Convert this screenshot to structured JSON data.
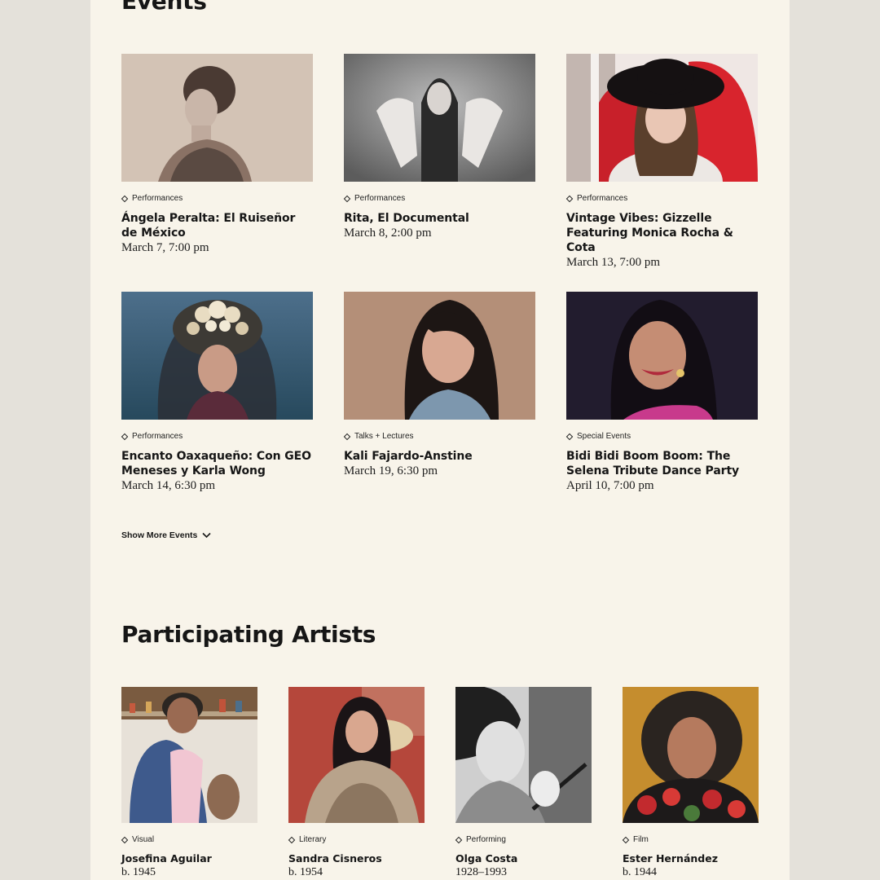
{
  "events_section": {
    "title": "Events",
    "events": [
      {
        "category": "Performances",
        "title": "Ángela Peralta: El Ruiseñor de México",
        "date": "March 7, 7:00 pm"
      },
      {
        "category": "Performances",
        "title": "Rita, El Documental",
        "date": "March 8, 2:00 pm"
      },
      {
        "category": "Performances",
        "title": "Vintage Vibes: Gizzelle Featuring Monica Rocha & Cota",
        "date": "March 13, 7:00 pm"
      },
      {
        "category": "Performances",
        "title": "Encanto Oaxaqueño: Con GEO Meneses y Karla Wong",
        "date": "March 14, 6:30 pm"
      },
      {
        "category": "Talks + Lectures",
        "title": "Kali Fajardo-Anstine",
        "date": "March 19, 6:30 pm"
      },
      {
        "category": "Special Events",
        "title": "Bidi Bidi Boom Boom: The Selena Tribute Dance Party",
        "date": "April 10, 7:00 pm"
      }
    ],
    "show_more_label": "Show More Events"
  },
  "artists_section": {
    "title": "Participating Artists",
    "artists": [
      {
        "category": "Visual",
        "name": "Josefina Aguilar",
        "years": "b. 1945"
      },
      {
        "category": "Literary",
        "name": "Sandra Cisneros",
        "years": "b. 1954"
      },
      {
        "category": "Performing",
        "name": "Olga Costa",
        "years": "1928–1993"
      },
      {
        "category": "Film",
        "name": "Ester Hernández",
        "years": "b. 1944"
      }
    ]
  },
  "colors": {
    "page_background": "#e4e1da",
    "panel_background": "#f8f4ea",
    "text": "#161616"
  },
  "icons": {
    "category_marker": "diamond-icon",
    "show_more": "chevron-down-icon"
  }
}
